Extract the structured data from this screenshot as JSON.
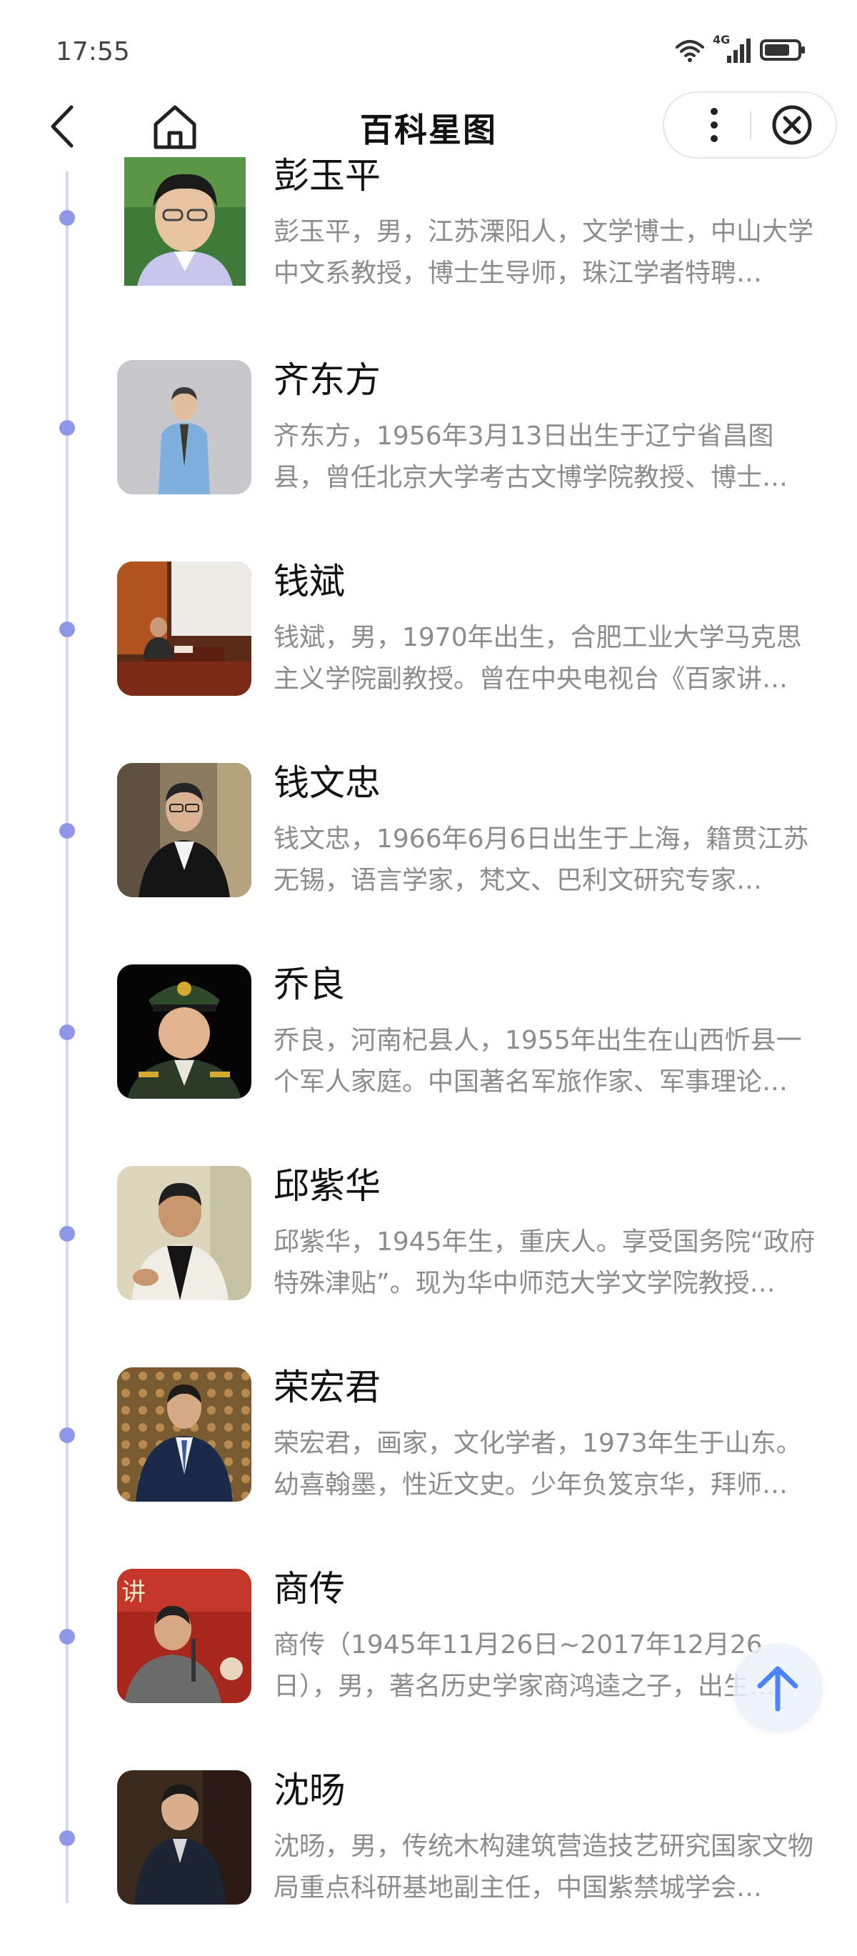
{
  "status_bar": {
    "time": "17:55",
    "network": "4G",
    "icons": [
      "wifi-icon",
      "signal-icon",
      "battery-icon"
    ]
  },
  "nav": {
    "title": "百科星图",
    "icons": [
      "back-icon",
      "home-icon",
      "more-icon",
      "close-icon"
    ]
  },
  "colors": {
    "timeline_line": "#d6d8f5",
    "timeline_dot": "#8f97e8",
    "name_text": "#111111",
    "desc_text": "#8c8c8c",
    "scroll_top_arrow": "#4c84ff"
  },
  "list": {
    "items": [
      {
        "name": "彭玉平",
        "desc": "彭玉平，男，江苏溧阳人，文学博士，中山大学中文系教授，博士生导师，珠江学者特聘…"
      },
      {
        "name": "齐东方",
        "desc": "齐东方，1956年3月13日出生于辽宁省昌图县，曾任北京大学考古文博学院教授、博士…"
      },
      {
        "name": "钱斌",
        "desc": "钱斌，男，1970年出生，合肥工业大学马克思主义学院副教授。曾在中央电视台《百家讲…"
      },
      {
        "name": "钱文忠",
        "desc": "钱文忠，1966年6月6日出生于上海，籍贯江苏无锡，语言学家，梵文、巴利文研究专家…"
      },
      {
        "name": "乔良",
        "desc": "乔良，河南杞县人，1955年出生在山西忻县一个军人家庭。中国著名军旅作家、军事理论…"
      },
      {
        "name": "邱紫华",
        "desc": "邱紫华，1945年生，重庆人。享受国务院“政府特殊津贴”。现为华中师范大学文学院教授…"
      },
      {
        "name": "荣宏君",
        "desc": "荣宏君，画家，文化学者，1973年生于山东。幼喜翰墨，性近文史。少年负笈京华，拜师…"
      },
      {
        "name": "商传",
        "desc": "商传（1945年11月26日~2017年12月26日），男，著名历史学家商鸿逵之子，出生…"
      },
      {
        "name": "沈旸",
        "desc": "沈旸，男，传统木构建筑营造技艺研究国家文物局重点科研基地副主任，中国紫禁城学会…"
      }
    ]
  },
  "scroll_top": {
    "icon": "arrow-up-icon"
  }
}
